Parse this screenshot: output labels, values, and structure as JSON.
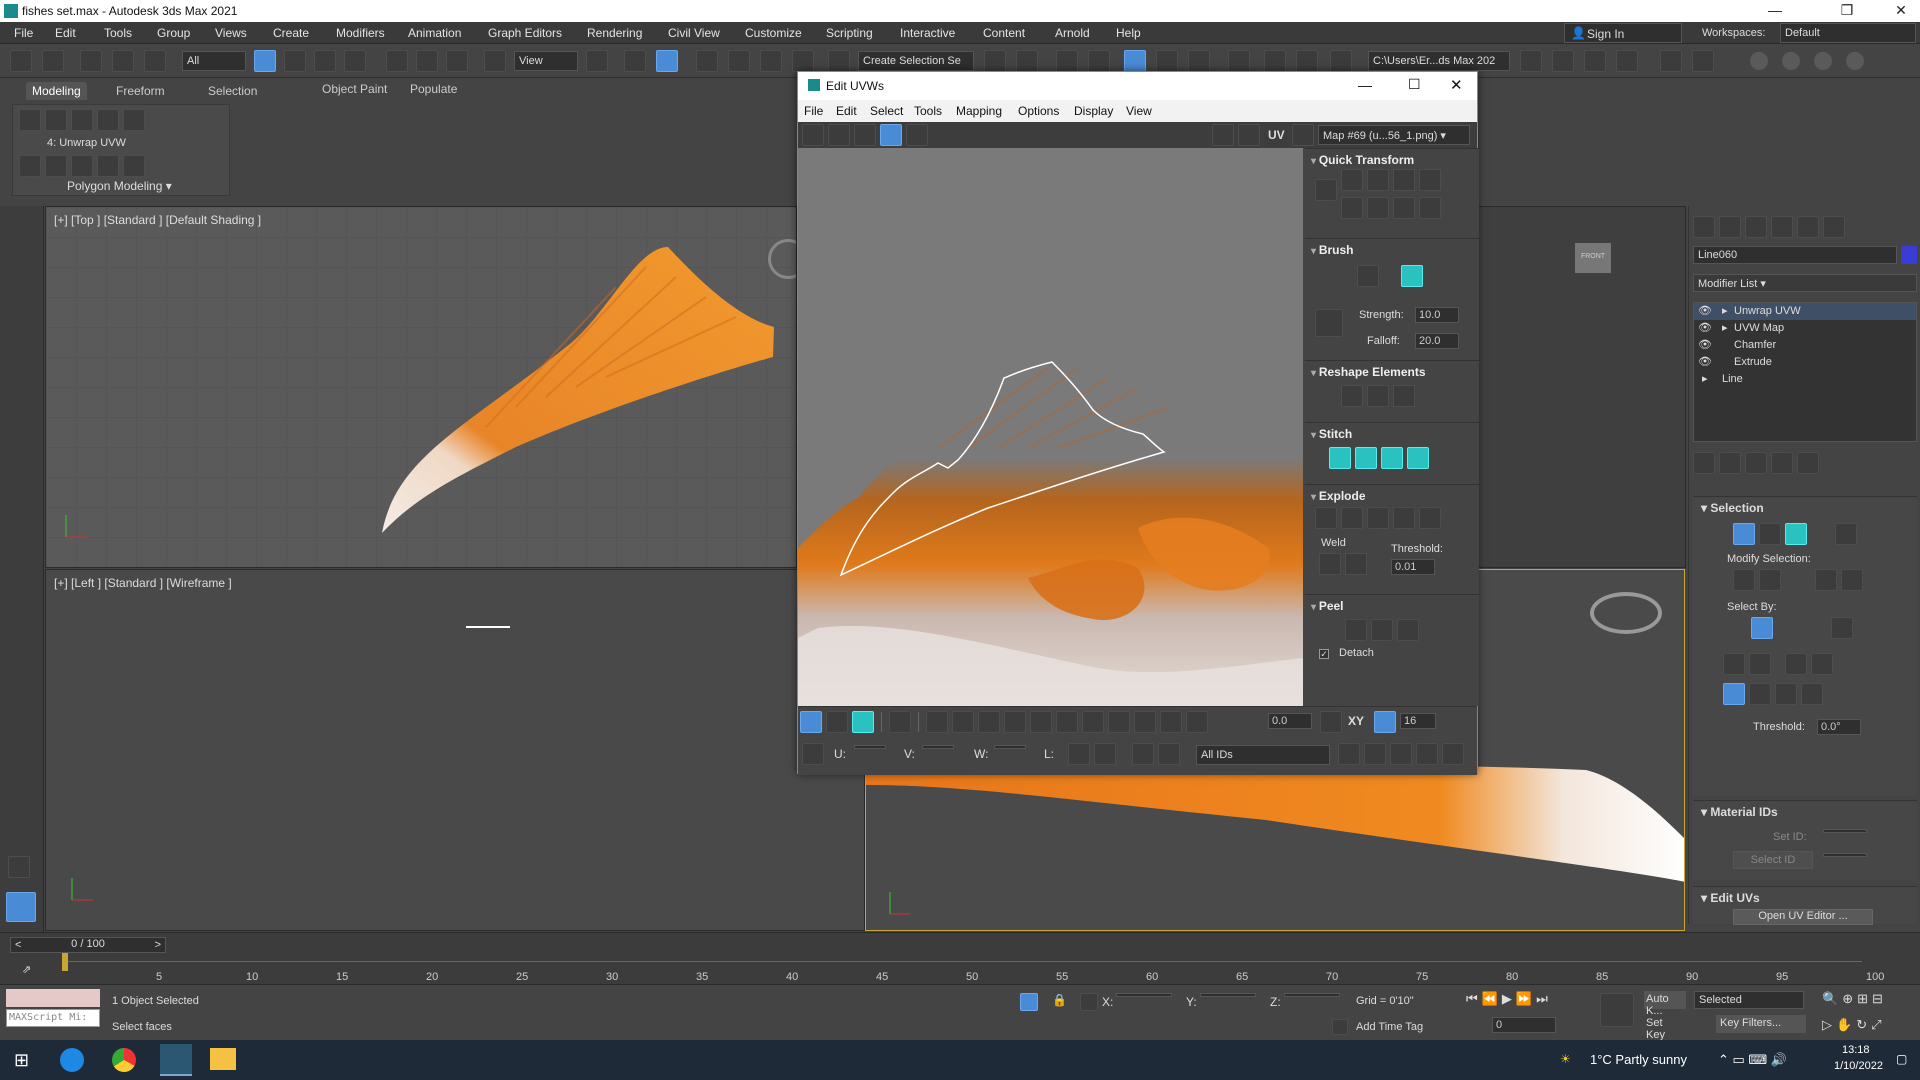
{
  "app": {
    "title": "fishes set.max - Autodesk 3ds Max 2021",
    "menu": [
      "File",
      "Edit",
      "Tools",
      "Group",
      "Views",
      "Create",
      "Modifiers",
      "Animation",
      "Graph Editors",
      "Rendering",
      "Civil View",
      "Customize",
      "Scripting",
      "Interactive",
      "Content",
      "Arnold",
      "Help"
    ],
    "sign_in": "Sign In",
    "workspaces_label": "Workspaces:",
    "workspace": "Default"
  },
  "toolbar": {
    "filter": "All",
    "ref_coord": "View",
    "named_selection": "Create Selection Se",
    "project_path": "C:\\Users\\Er...ds Max 202"
  },
  "ribbon": {
    "tabs": [
      "Modeling",
      "Freeform",
      "Selection",
      "Object Paint",
      "Populate"
    ],
    "modifier_label": "4: Unwrap UVW",
    "panel_label": "Polygon Modeling"
  },
  "viewports": {
    "top": "[+] [Top ] [Standard ] [Default Shading ]",
    "left": "[+] [Left ] [Standard ] [Wireframe ]",
    "front_cube": "FRONT"
  },
  "uvw_editor": {
    "title": "Edit UVWs",
    "menu": [
      "File",
      "Edit",
      "Select",
      "Tools",
      "Mapping",
      "Options",
      "Display",
      "View"
    ],
    "uv_label": "UV",
    "map_select": "Map #69 (u...56_1.png)",
    "rollouts": {
      "quick_transform": "Quick Transform",
      "brush": "Brush",
      "strength_label": "Strength:",
      "strength": "10.0",
      "falloff_label": "Falloff:",
      "falloff": "20.0",
      "reshape": "Reshape Elements",
      "stitch": "Stitch",
      "explode": "Explode",
      "weld": "Weld",
      "threshold_label": "Threshold:",
      "threshold": "0.01",
      "peel": "Peel",
      "detach": "Detach"
    },
    "bottom": {
      "angle": "0.0",
      "xy": "XY",
      "pixels": "16",
      "u": "U:",
      "v": "V:",
      "w": "W:",
      "l": "L:",
      "ids": "All IDs"
    }
  },
  "command_panel": {
    "object_name": "Line060",
    "modifier_list": "Modifier List",
    "stack": [
      "Unwrap UVW",
      "UVW Map",
      "Chamfer",
      "Extrude",
      "Line"
    ],
    "selection_title": "Selection",
    "modify_selection": "Modify Selection:",
    "select_by": "Select By:",
    "threshold_label": "Threshold:",
    "threshold": "0.0°",
    "material_ids": "Material IDs",
    "set_id": "Set ID:",
    "select_id": "Select ID",
    "edit_uvs": "Edit UVs",
    "open_uv_editor": "Open UV Editor ..."
  },
  "timeline": {
    "frame": "0 / 100",
    "ticks": [
      "5",
      "10",
      "15",
      "20",
      "25",
      "30",
      "35",
      "40",
      "45",
      "50",
      "55",
      "60",
      "65",
      "70",
      "75",
      "80",
      "85",
      "90",
      "95",
      "100"
    ]
  },
  "status": {
    "maxscript": "MAXScript Mi:",
    "selected": "1 Object Selected",
    "prompt": "Select faces",
    "x": "X:",
    "y": "Y:",
    "z": "Z:",
    "grid": "Grid = 0'10\"",
    "add_time_tag": "Add Time Tag",
    "auto_key": "Auto K...",
    "set_key": "Set Key",
    "selected_mode": "Selected",
    "key_filters": "Key Filters...",
    "frame_field": "0"
  },
  "taskbar": {
    "weather": "1°C  Partly sunny",
    "time": "13:18",
    "date": "1/10/2022"
  },
  "colors": {
    "accent": "#4a8bd6",
    "teal": "#2ac1c1",
    "fish_orange": "#e8761a",
    "bg": "#444444"
  }
}
